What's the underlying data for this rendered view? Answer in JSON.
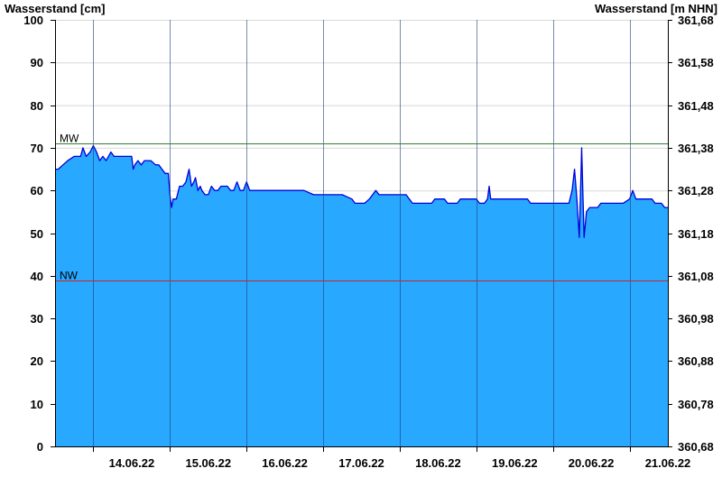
{
  "chart_data": {
    "type": "area",
    "ylabel_left": "Wasserstand [cm]",
    "ylabel_right": "Wasserstand [m NHN]",
    "ylim": [
      0,
      100
    ],
    "y_ticks": [
      0,
      10,
      20,
      30,
      40,
      50,
      60,
      70,
      80,
      90,
      100
    ],
    "y_right_ticks": [
      "360,68",
      "360,78",
      "360,88",
      "360,98",
      "361,08",
      "361,18",
      "361,28",
      "361,38",
      "361,48",
      "361,58",
      "361,68"
    ],
    "xlim": [
      "2022-06-13T12:00",
      "2022-06-21T12:00"
    ],
    "x_ticks": [
      "14.06.22",
      "15.06.22",
      "16.06.22",
      "17.06.22",
      "18.06.22",
      "19.06.22",
      "20.06.22",
      "21.06.22"
    ],
    "grid": true,
    "colors": {
      "fill": "#29a8ff",
      "line": "#0000dd",
      "mw": "#2e7d32",
      "nw": "#c62828"
    },
    "reference_lines": [
      {
        "name": "MW",
        "value": 71
      },
      {
        "name": "NW",
        "value": 39
      }
    ],
    "series": [
      {
        "points": [
          [
            "2022-06-13T12:00",
            65
          ],
          [
            "2022-06-13T13:00",
            65
          ],
          [
            "2022-06-13T14:30",
            66
          ],
          [
            "2022-06-13T16:00",
            67
          ],
          [
            "2022-06-13T18:00",
            68
          ],
          [
            "2022-06-13T20:00",
            68
          ],
          [
            "2022-06-13T20:45",
            70
          ],
          [
            "2022-06-13T21:45",
            68
          ],
          [
            "2022-06-13T23:00",
            69
          ],
          [
            "2022-06-14T00:00",
            70.5
          ],
          [
            "2022-06-14T01:00",
            69
          ],
          [
            "2022-06-14T02:00",
            67
          ],
          [
            "2022-06-14T03:00",
            68
          ],
          [
            "2022-06-14T04:00",
            67
          ],
          [
            "2022-06-14T05:30",
            69
          ],
          [
            "2022-06-14T06:30",
            68
          ],
          [
            "2022-06-14T10:00",
            68
          ],
          [
            "2022-06-14T12:00",
            68
          ],
          [
            "2022-06-14T12:30",
            65
          ],
          [
            "2022-06-14T13:00",
            66
          ],
          [
            "2022-06-14T14:00",
            67
          ],
          [
            "2022-06-14T15:00",
            66
          ],
          [
            "2022-06-14T16:00",
            67
          ],
          [
            "2022-06-14T18:00",
            67
          ],
          [
            "2022-06-14T19:30",
            66
          ],
          [
            "2022-06-14T20:30",
            66
          ],
          [
            "2022-06-14T21:30",
            65
          ],
          [
            "2022-06-14T22:30",
            64
          ],
          [
            "2022-06-14T23:30",
            64
          ],
          [
            "2022-06-15T00:00",
            59
          ],
          [
            "2022-06-15T00:30",
            56
          ],
          [
            "2022-06-15T01:00",
            58
          ],
          [
            "2022-06-15T02:00",
            58
          ],
          [
            "2022-06-15T03:00",
            61
          ],
          [
            "2022-06-15T04:00",
            61
          ],
          [
            "2022-06-15T05:00",
            62
          ],
          [
            "2022-06-15T06:00",
            65
          ],
          [
            "2022-06-15T06:45",
            61
          ],
          [
            "2022-06-15T07:30",
            62
          ],
          [
            "2022-06-15T08:00",
            63
          ],
          [
            "2022-06-15T08:45",
            60
          ],
          [
            "2022-06-15T09:30",
            61
          ],
          [
            "2022-06-15T10:00",
            60
          ],
          [
            "2022-06-15T11:00",
            59
          ],
          [
            "2022-06-15T12:00",
            59
          ],
          [
            "2022-06-15T13:00",
            61
          ],
          [
            "2022-06-15T14:00",
            60
          ],
          [
            "2022-06-15T15:00",
            60
          ],
          [
            "2022-06-15T16:00",
            61
          ],
          [
            "2022-06-15T18:00",
            61
          ],
          [
            "2022-06-15T19:00",
            60
          ],
          [
            "2022-06-15T20:00",
            60
          ],
          [
            "2022-06-15T21:00",
            62
          ],
          [
            "2022-06-15T22:00",
            60
          ],
          [
            "2022-06-15T23:00",
            60
          ],
          [
            "2022-06-16T00:00",
            62
          ],
          [
            "2022-06-16T01:00",
            60
          ],
          [
            "2022-06-16T04:00",
            60
          ],
          [
            "2022-06-16T08:00",
            60
          ],
          [
            "2022-06-16T12:00",
            60
          ],
          [
            "2022-06-16T18:00",
            60
          ],
          [
            "2022-06-16T21:00",
            59
          ],
          [
            "2022-06-17T00:00",
            59
          ],
          [
            "2022-06-17T06:00",
            59
          ],
          [
            "2022-06-17T09:00",
            58
          ],
          [
            "2022-06-17T10:00",
            57
          ],
          [
            "2022-06-17T13:00",
            57
          ],
          [
            "2022-06-17T14:30",
            58
          ],
          [
            "2022-06-17T15:30",
            59
          ],
          [
            "2022-06-17T16:30",
            60
          ],
          [
            "2022-06-17T17:30",
            59
          ],
          [
            "2022-06-18T00:00",
            59
          ],
          [
            "2022-06-18T02:00",
            59
          ],
          [
            "2022-06-18T03:00",
            58
          ],
          [
            "2022-06-18T04:00",
            57
          ],
          [
            "2022-06-18T10:00",
            57
          ],
          [
            "2022-06-18T11:00",
            58
          ],
          [
            "2022-06-18T14:00",
            58
          ],
          [
            "2022-06-18T15:00",
            57
          ],
          [
            "2022-06-18T18:00",
            57
          ],
          [
            "2022-06-18T19:00",
            58
          ],
          [
            "2022-06-19T00:00",
            58
          ],
          [
            "2022-06-19T01:00",
            57
          ],
          [
            "2022-06-19T02:30",
            57
          ],
          [
            "2022-06-19T03:30",
            58
          ],
          [
            "2022-06-19T04:00",
            61
          ],
          [
            "2022-06-19T04:30",
            58
          ],
          [
            "2022-06-19T12:00",
            58
          ],
          [
            "2022-06-19T16:00",
            58
          ],
          [
            "2022-06-19T17:00",
            57
          ],
          [
            "2022-06-20T00:00",
            57
          ],
          [
            "2022-06-20T05:00",
            57
          ],
          [
            "2022-06-20T06:00",
            60
          ],
          [
            "2022-06-20T06:45",
            65
          ],
          [
            "2022-06-20T07:30",
            58
          ],
          [
            "2022-06-20T08:15",
            49
          ],
          [
            "2022-06-20T09:00",
            70
          ],
          [
            "2022-06-20T09:45",
            49
          ],
          [
            "2022-06-20T10:30",
            55
          ],
          [
            "2022-06-20T11:30",
            56
          ],
          [
            "2022-06-20T14:00",
            56
          ],
          [
            "2022-06-20T15:00",
            57
          ],
          [
            "2022-06-20T22:00",
            57
          ],
          [
            "2022-06-21T00:00",
            58
          ],
          [
            "2022-06-21T01:00",
            60
          ],
          [
            "2022-06-21T02:00",
            58
          ],
          [
            "2022-06-21T03:00",
            58
          ],
          [
            "2022-06-21T07:00",
            58
          ],
          [
            "2022-06-21T08:00",
            57
          ],
          [
            "2022-06-21T10:00",
            57
          ],
          [
            "2022-06-21T11:00",
            56
          ],
          [
            "2022-06-21T12:00",
            56
          ]
        ]
      }
    ]
  }
}
